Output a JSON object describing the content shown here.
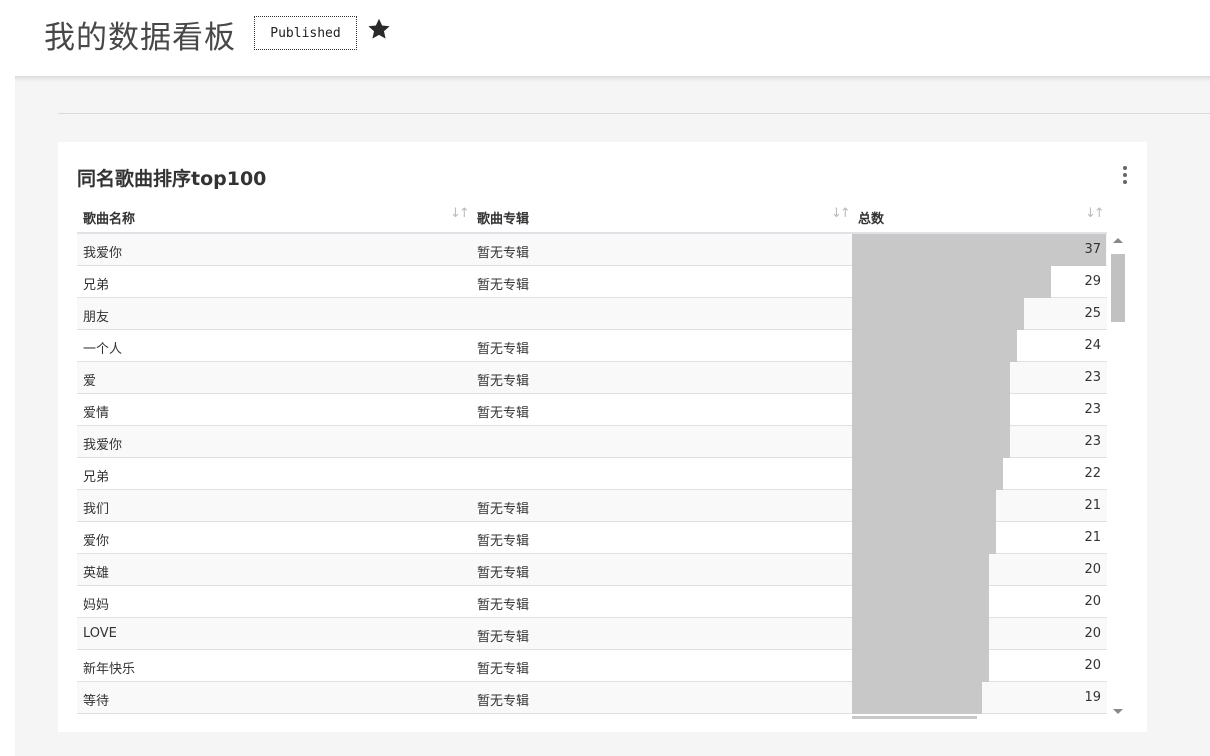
{
  "page": {
    "title": "我的数据看板",
    "status_badge": "Published",
    "star_icon": "star-icon"
  },
  "card": {
    "title": "同名歌曲排序top100",
    "menu_icon": "more-vertical-icon",
    "columns": [
      "歌曲名称",
      "歌曲专辑",
      "总数"
    ],
    "sort_icon": "sort-arrows-icon",
    "bar_color": "#c8c8c8",
    "max_value": 37,
    "rows": [
      {
        "name": "我爱你",
        "album": "暂无专辑",
        "count": 37
      },
      {
        "name": "兄弟",
        "album": "暂无专辑",
        "count": 29
      },
      {
        "name": "朋友",
        "album": "",
        "count": 25
      },
      {
        "name": "一个人",
        "album": "暂无专辑",
        "count": 24
      },
      {
        "name": "爱",
        "album": "暂无专辑",
        "count": 23
      },
      {
        "name": "爱情",
        "album": "暂无专辑",
        "count": 23
      },
      {
        "name": "我爱你",
        "album": "",
        "count": 23
      },
      {
        "name": "兄弟",
        "album": "",
        "count": 22
      },
      {
        "name": "我们",
        "album": "暂无专辑",
        "count": 21
      },
      {
        "name": "爱你",
        "album": "暂无专辑",
        "count": 21
      },
      {
        "name": "英雄",
        "album": "暂无专辑",
        "count": 20
      },
      {
        "name": "妈妈",
        "album": "暂无专辑",
        "count": 20
      },
      {
        "name": "LOVE",
        "album": "暂无专辑",
        "count": 20
      },
      {
        "name": "新年快乐",
        "album": "暂无专辑",
        "count": 20
      },
      {
        "name": "等待",
        "album": "暂无专辑",
        "count": 19
      }
    ]
  }
}
